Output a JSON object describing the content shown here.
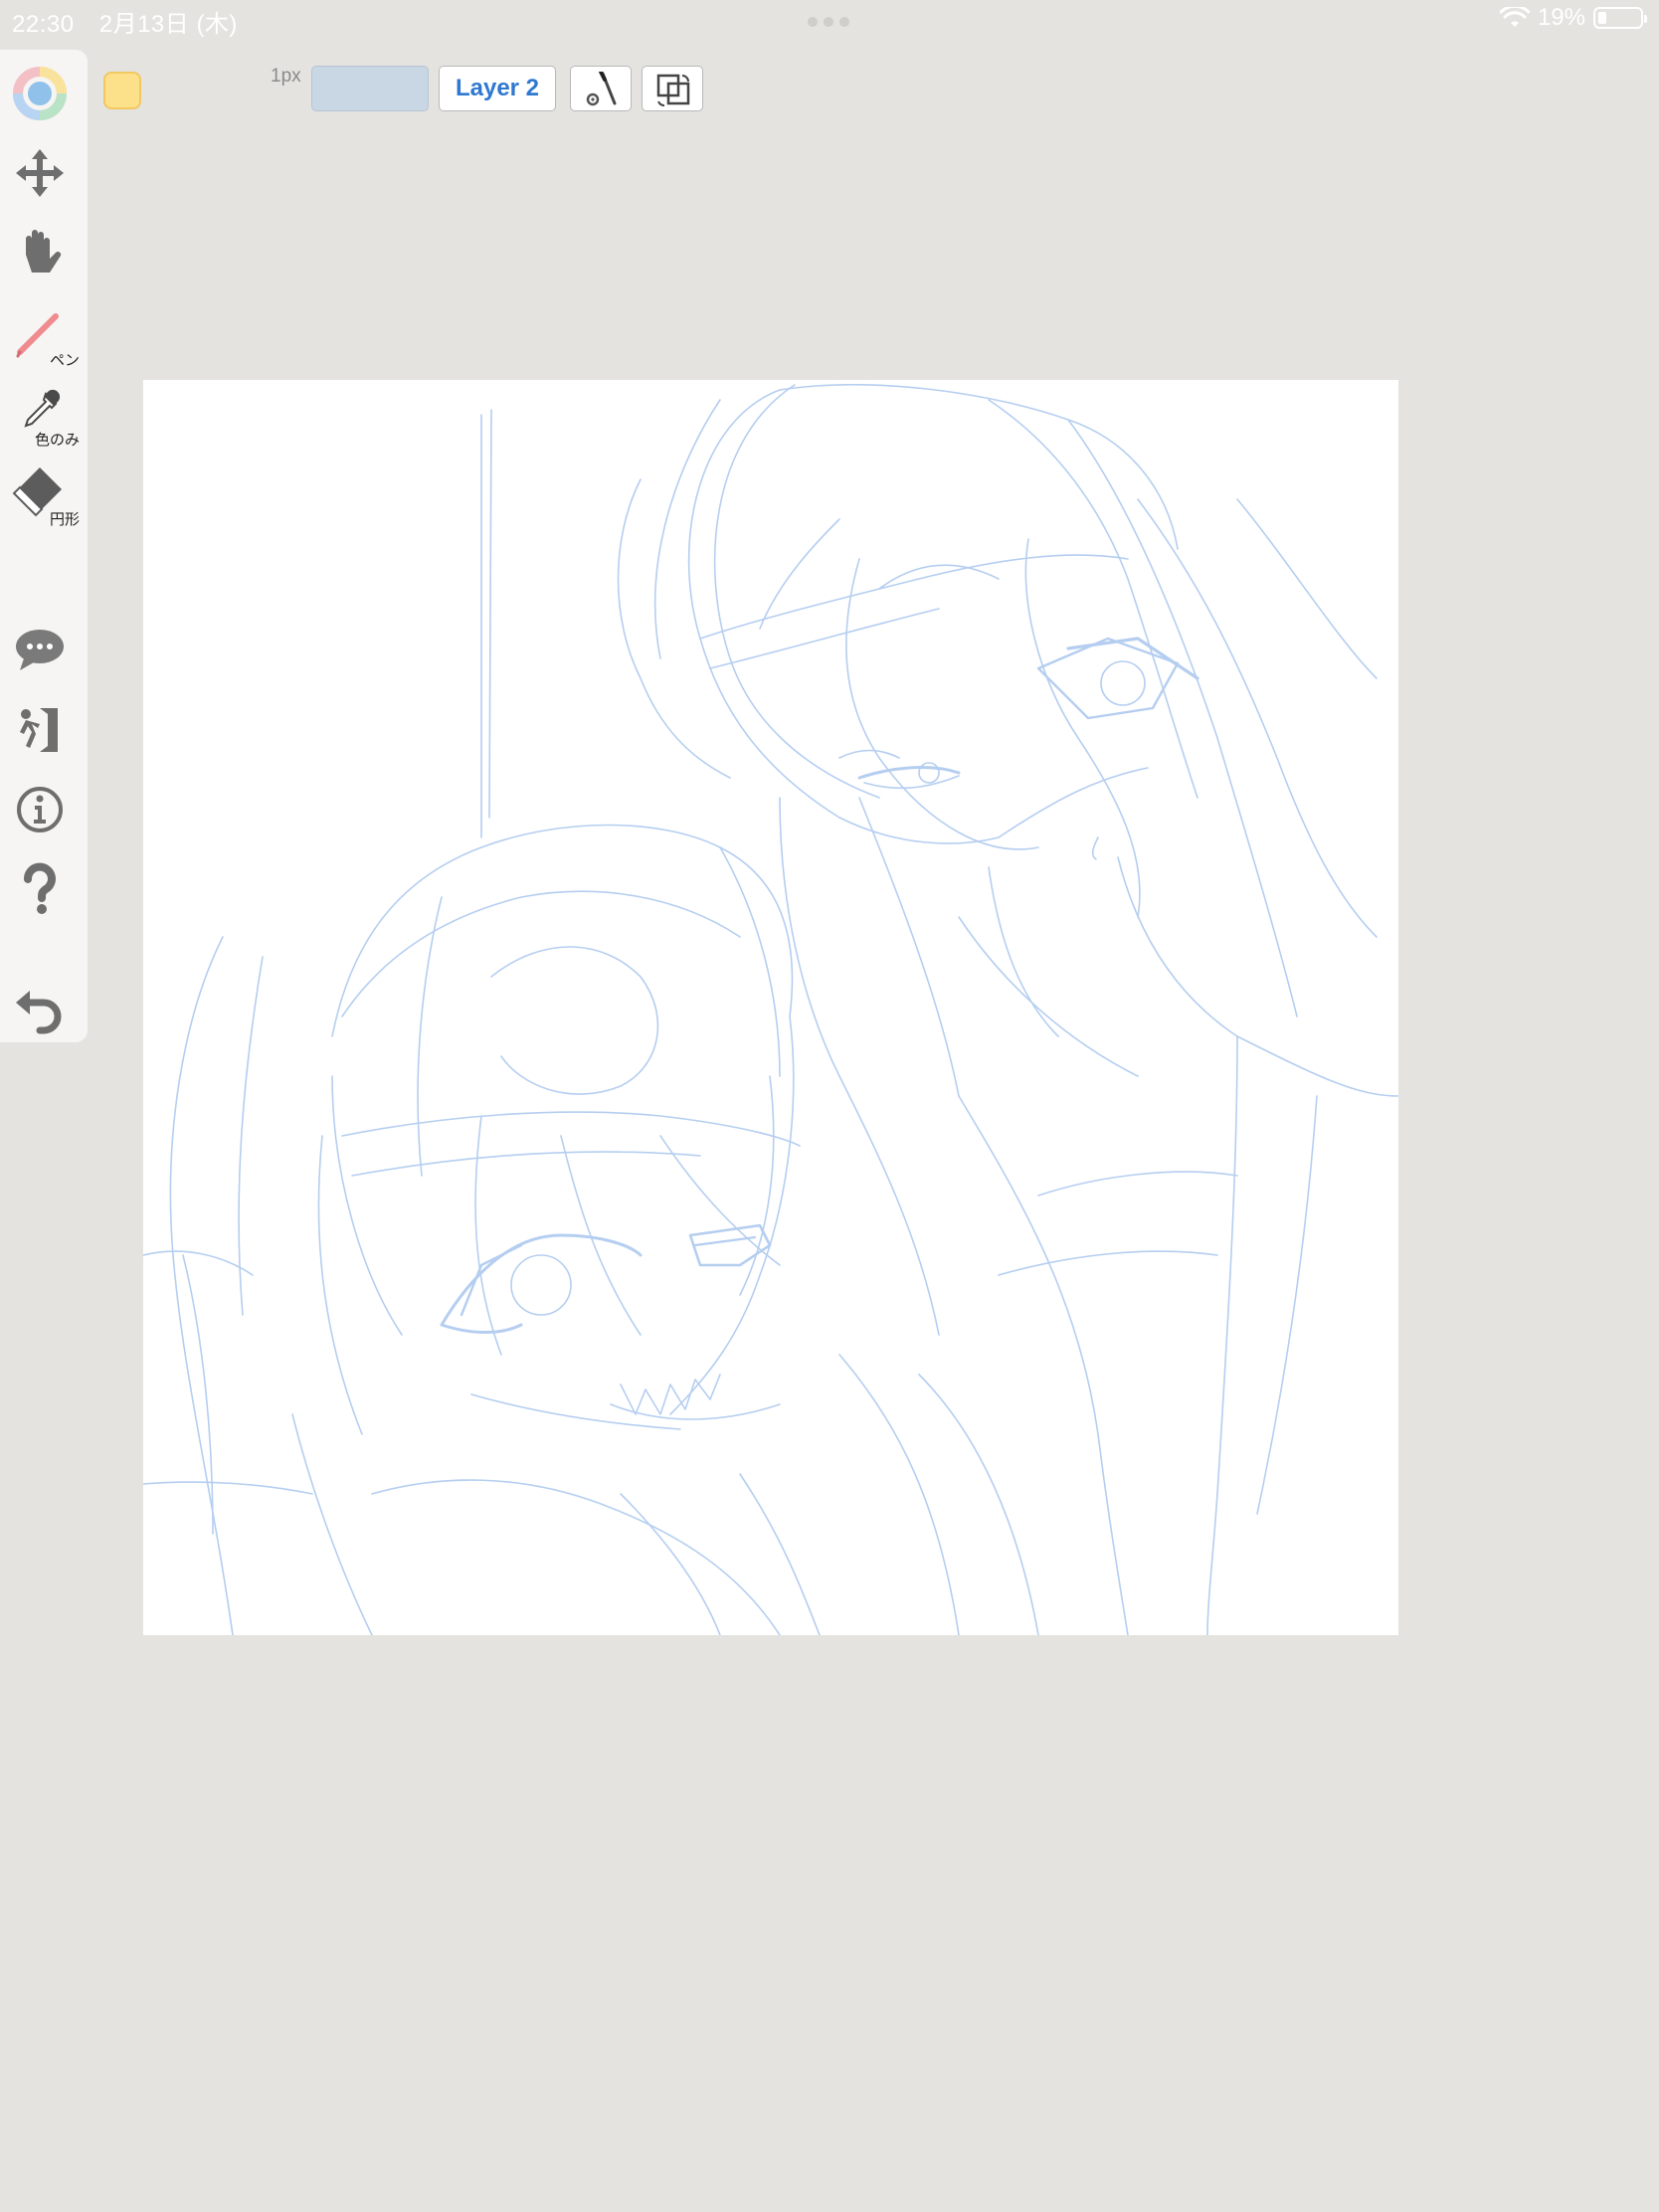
{
  "status_bar": {
    "time": "22:30",
    "date": "2月13日 (木)",
    "battery": "19%",
    "battery_level": 0.19
  },
  "sidebar": {
    "tools": [
      {
        "name": "color-wheel"
      },
      {
        "name": "move"
      },
      {
        "name": "hand"
      },
      {
        "name": "pen",
        "label": "ペン"
      },
      {
        "name": "eyedropper",
        "label": "色のみ"
      },
      {
        "name": "eraser",
        "label": "円形"
      },
      {
        "name": "chat"
      },
      {
        "name": "exit"
      },
      {
        "name": "info"
      },
      {
        "name": "help"
      },
      {
        "name": "undo"
      }
    ]
  },
  "toolbar": {
    "color": "#fde08a",
    "brush_size": "1px",
    "layer_label": "Layer 2"
  },
  "canvas": {
    "background": "#ffffff",
    "sketch_color": "#a9c6ee"
  }
}
